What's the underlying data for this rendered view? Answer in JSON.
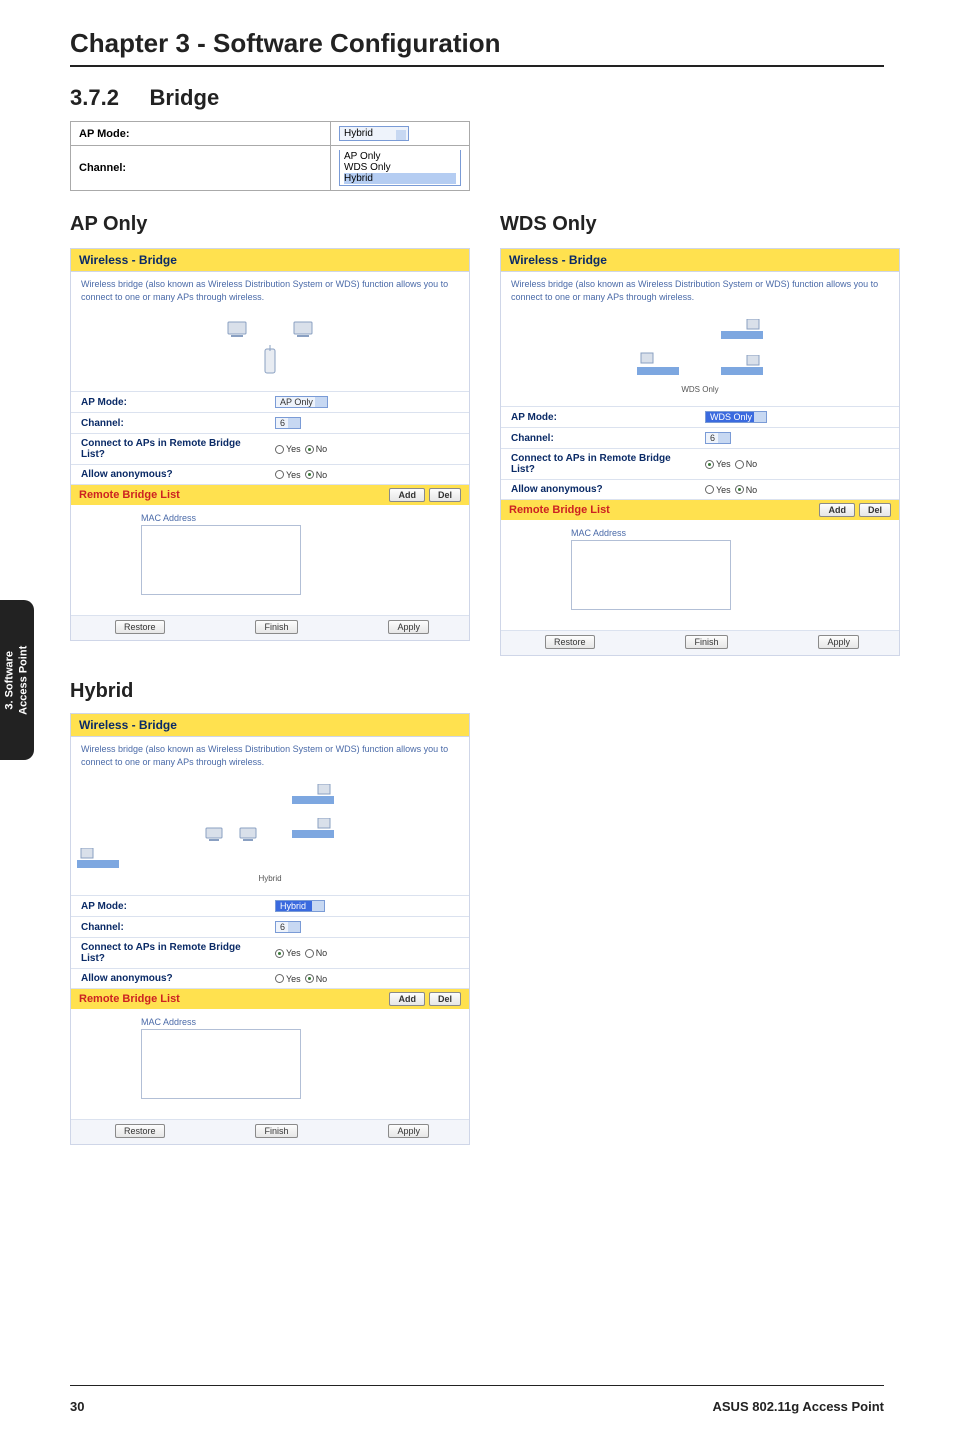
{
  "chapterTitle": "Chapter 3 - Software Configuration",
  "sectionNumber": "3.7.2",
  "sectionName": "Bridge",
  "sideTab": "3. Software\nAccess Point",
  "footer": {
    "page": "30",
    "product": "ASUS 802.11g Access Point"
  },
  "modeTable": {
    "apModeLabel": "AP Mode:",
    "channelLabel": "Channel:",
    "dropdownSelected": "Hybrid",
    "options": [
      "AP Only",
      "WDS Only",
      "Hybrid"
    ],
    "optionsHighlighted": "Hybrid"
  },
  "panelsCommon": {
    "headerText": "Wireless - Bridge",
    "desc": "Wireless bridge (also known as Wireless Distribution System or WDS) function allows you to connect to one or many APs through wireless.",
    "fields": {
      "apMode": "AP Mode:",
      "channel": "Channel:",
      "connectRemote": "Connect to APs in Remote Bridge List?",
      "allowAnon": "Allow anonymous?"
    },
    "remoteHeader": "Remote Bridge List",
    "macLabel": "MAC Address",
    "buttons": {
      "add": "Add",
      "del": "Del",
      "restore": "Restore",
      "finish": "Finish",
      "apply": "Apply"
    },
    "yes": "Yes",
    "no": "No"
  },
  "apOnly": {
    "title": "AP Only",
    "apModeValue": "AP Only",
    "channelValue": "6",
    "connectRemote": "No",
    "allowAnon": "No",
    "topologyLabel": ""
  },
  "wdsOnly": {
    "title": "WDS Only",
    "apModeValue": "WDS Only",
    "channelValue": "6",
    "connectRemote": "Yes",
    "allowAnon": "No",
    "topologyLabel": "WDS Only"
  },
  "hybrid": {
    "title": "Hybrid",
    "apModeValue": "Hybrid",
    "channelValue": "6",
    "connectRemote": "Yes",
    "allowAnon": "No",
    "topologyLabel": "Hybrid"
  }
}
